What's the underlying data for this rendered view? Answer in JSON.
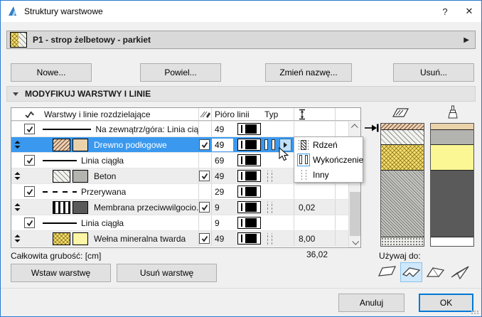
{
  "window": {
    "title": "Struktury warstwowe",
    "help": "?",
    "close": "✕"
  },
  "selector": {
    "label": "P1 - strop żelbetowy - parkiet"
  },
  "toolbar": {
    "new": "Nowe...",
    "duplicate": "Powiel...",
    "rename": "Zmień nazwę...",
    "delete": "Usuń..."
  },
  "section": {
    "title": "MODYFIKUJ WARSTWY I LINIE"
  },
  "table": {
    "headers": {
      "name": "Warstwy i linie rozdzielające",
      "pen": "Pióro linii",
      "type": "Typ"
    },
    "rows": [
      {
        "name": "Na zewnątrz/góra: Linia ciągła",
        "pen": "49",
        "thickness": ""
      },
      {
        "name": "Drewno podłogowe",
        "pen": "49",
        "thickness": ""
      },
      {
        "name": "Linia ciągła",
        "pen": "69",
        "thickness": ""
      },
      {
        "name": "Beton",
        "pen": "49",
        "thickness": ""
      },
      {
        "name": "Przerywana",
        "pen": "29",
        "thickness": ""
      },
      {
        "name": "Membrana przeciwwilgocio...",
        "pen": "9",
        "thickness": "0,02"
      },
      {
        "name": "Linia ciągła",
        "pen": "9",
        "thickness": ""
      },
      {
        "name": "Wełna mineralna twarda",
        "pen": "49",
        "thickness": "8,00"
      }
    ]
  },
  "popup": {
    "items": [
      {
        "label": "Rdzeń"
      },
      {
        "label": "Wykończenie"
      },
      {
        "label": "Inny"
      }
    ]
  },
  "total": {
    "label": "Całkowita grubość: [cm]",
    "value": "36,02"
  },
  "layer_buttons": {
    "insert": "Wstaw warstwę",
    "remove": "Usuń warstwę"
  },
  "use_for": {
    "label": "Używaj do:"
  },
  "footer": {
    "cancel": "Anuluj",
    "ok": "OK"
  },
  "colors": {
    "selection_blue": "#3a99ef",
    "ok_border_blue": "#0078d7",
    "wood_surface": "#ead2ab",
    "concrete_surface": "#b3b3af",
    "wool_surface": "#fbf795",
    "reinforced_surface": "#5a5a5a",
    "plaster_surface": "#ffffff"
  }
}
